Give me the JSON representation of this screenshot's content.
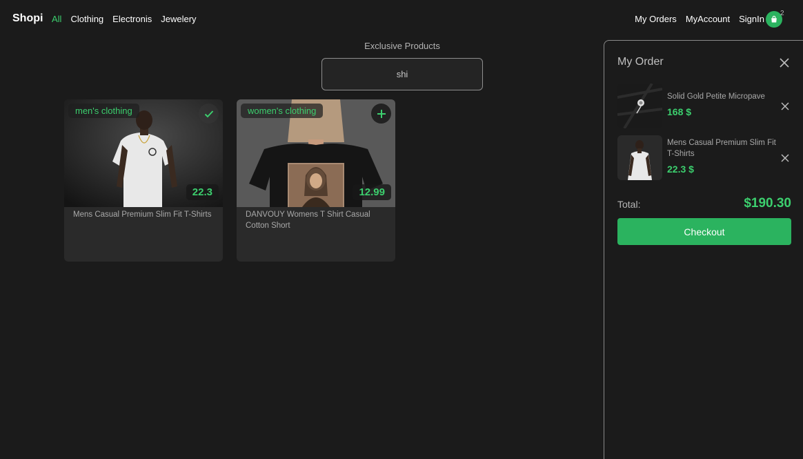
{
  "brand": "Shopi",
  "nav": {
    "left": [
      {
        "label": "All",
        "active": true
      },
      {
        "label": "Clothing",
        "active": false
      },
      {
        "label": "Electronis",
        "active": false
      },
      {
        "label": "Jewelery",
        "active": false
      }
    ],
    "right": [
      {
        "label": "My Orders"
      },
      {
        "label": "MyAccount"
      },
      {
        "label": "SignIn"
      }
    ],
    "cart_count": "2"
  },
  "main": {
    "title": "Exclusive Products",
    "search": {
      "value": "shi",
      "placeholder": ""
    }
  },
  "products": [
    {
      "category": "men's clothing",
      "price": "22.3",
      "title": "Mens Casual Premium Slim Fit T-Shirts",
      "action_icon": "check-icon"
    },
    {
      "category": "women's clothing",
      "price": "12.99",
      "title": "DANVOUY Womens T Shirt Casual Cotton Short",
      "action_icon": "plus-icon"
    }
  ],
  "order_panel": {
    "title": "My Order",
    "items": [
      {
        "name": "Solid Gold Petite Micropave",
        "price": "168 $"
      },
      {
        "name": "Mens Casual Premium Slim Fit T-Shirts",
        "price": "22.3 $"
      }
    ],
    "total_label": "Total:",
    "total_value": "$190.30",
    "checkout_label": "Checkout"
  },
  "colors": {
    "accent": "#3ccf6e",
    "button": "#2bb35f",
    "background": "#1b1b1b",
    "card": "#2a2a2a"
  }
}
